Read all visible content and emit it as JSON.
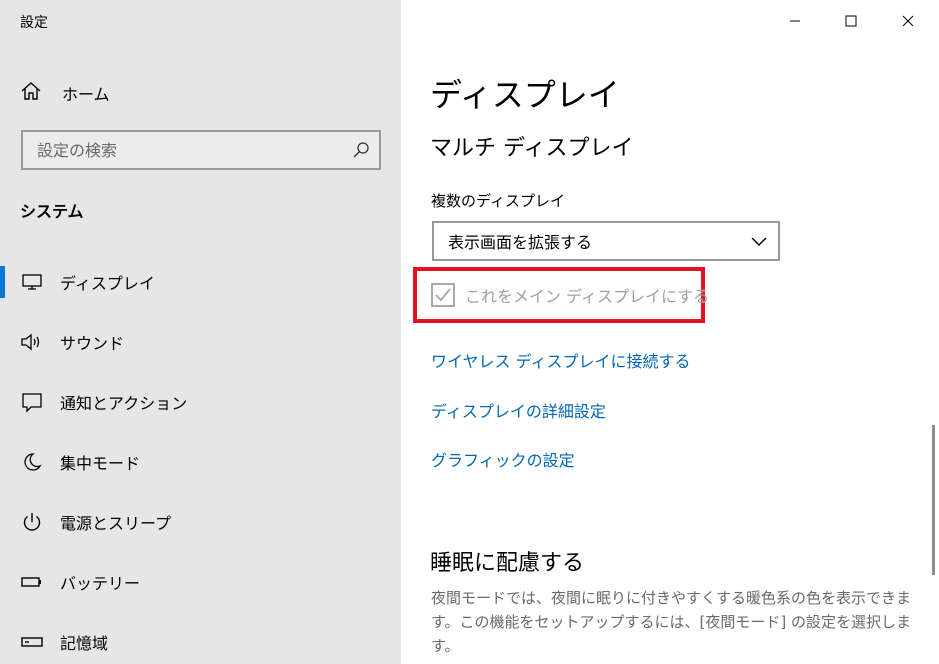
{
  "window": {
    "title": "設定"
  },
  "sidebar": {
    "home_label": "ホーム",
    "search_placeholder": "設定の検索",
    "section_title": "システム",
    "items": [
      {
        "label": "ディスプレイ",
        "icon": "monitor-icon",
        "active": true
      },
      {
        "label": "サウンド",
        "icon": "speaker-icon"
      },
      {
        "label": "通知とアクション",
        "icon": "notification-icon"
      },
      {
        "label": "集中モード",
        "icon": "moon-icon"
      },
      {
        "label": "電源とスリープ",
        "icon": "power-icon"
      },
      {
        "label": "バッテリー",
        "icon": "battery-icon"
      },
      {
        "label": "記憶域",
        "icon": "storage-icon"
      }
    ]
  },
  "main": {
    "title": "ディスプレイ",
    "multi_display_heading": "マルチ ディスプレイ",
    "multiple_displays_label": "複数のディスプレイ",
    "multiple_displays_value": "表示画面を拡張する",
    "main_display_checkbox": "これをメイン ディスプレイにする",
    "links": [
      "ワイヤレス ディスプレイに接続する",
      "ディスプレイの詳細設定",
      "グラフィックの設定"
    ],
    "sleep_heading": "睡眠に配慮する",
    "sleep_description": "夜間モードでは、夜間に眠りに付きやすくする暖色系の色を表示できます。この機能をセットアップするには、[夜間モード] の設定を選択しま す。"
  },
  "colors": {
    "accent": "#0078d7",
    "link": "#0067b8",
    "highlight": "#e81123",
    "sidebar_bg": "#e6e6e6"
  }
}
